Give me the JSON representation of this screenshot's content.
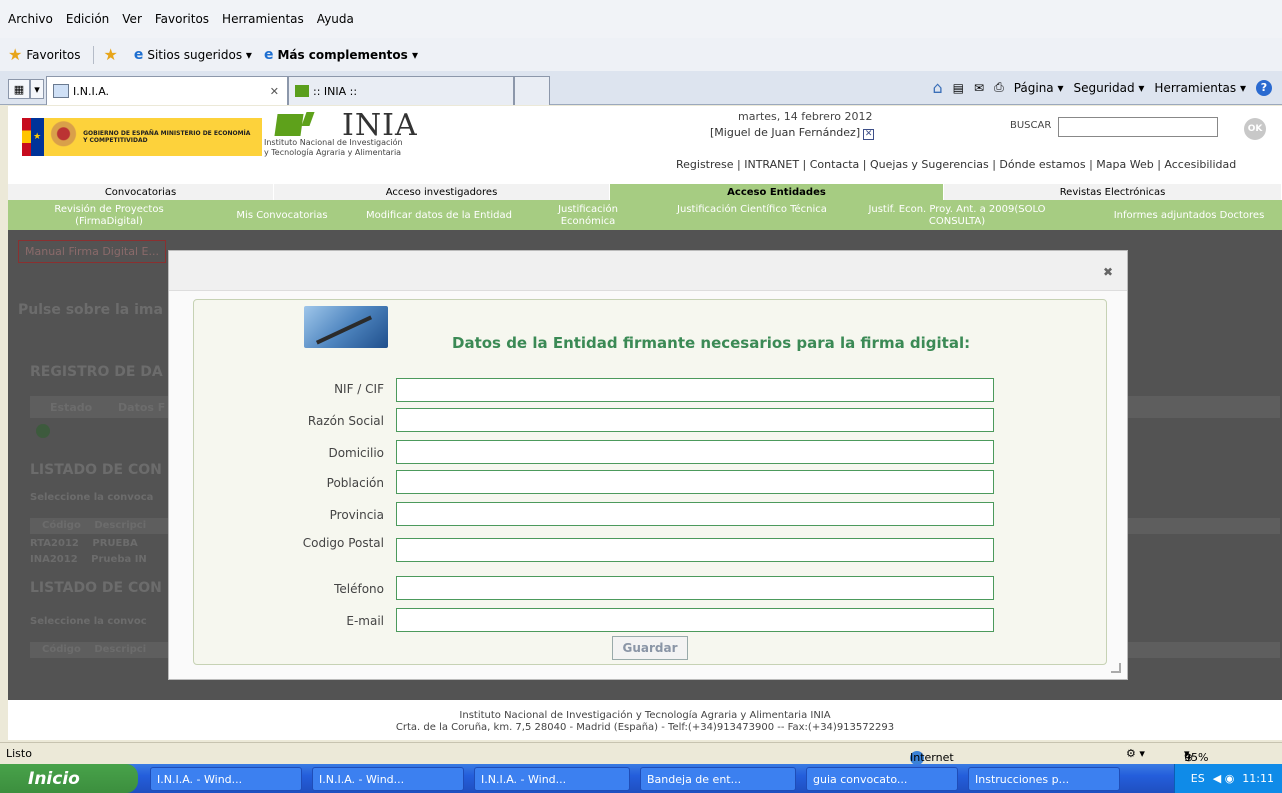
{
  "browser": {
    "menu": [
      "Archivo",
      "Edición",
      "Ver",
      "Favoritos",
      "Herramientas",
      "Ayuda"
    ],
    "favorites_bar": {
      "favorites": "Favoritos",
      "suggested": "Sitios sugeridos ▾",
      "addons": "Más complementos ▾"
    },
    "tabs": [
      {
        "label": "I.N.I.A.",
        "active": true
      },
      {
        "label": ":: INIA ::",
        "active": false
      }
    ],
    "command_bar": [
      "Página ▾",
      "Seguridad ▾",
      "Herramientas ▾"
    ],
    "status": {
      "left": "Listo",
      "zone": "Internet",
      "zoom": "95%"
    }
  },
  "site": {
    "gov_logo_text": "GOBIERNO DE ESPAÑA  MINISTERIO DE ECONOMÍA Y COMPETITIVIDAD",
    "inia_title": "INIA",
    "inia_subtitle_1": "Instituto Nacional de Investigación",
    "inia_subtitle_2": "y Tecnología Agraria y Alimentaria",
    "date": "martes, 14 febrero 2012",
    "user": "[Miguel de Juan Fernández]",
    "search_label": "BUSCAR",
    "search_ok": "OK",
    "top_links": "Registrese | INTRANET | Contacta | Quejas y Sugerencias | Dónde estamos | Mapa Web | Accesibilidad",
    "main_nav": [
      "Convocatorias",
      "Acceso investigadores",
      "Acceso Entidades",
      "Revistas Electrónicas"
    ],
    "sub_nav": [
      "Revisión de Proyectos (FirmaDigital)",
      "Mis Convocatorias",
      "Modificar datos de la Entidad",
      "Justificación Económica",
      "Justificación Científico Técnica",
      "Justif. Econ. Proy. Ant. a 2009(SOLO CONSULTA)",
      "Informes adjuntados Doctores"
    ],
    "background": {
      "manual_btn": "Manual Firma Digital E...",
      "pulse": "Pulse sobre la ima",
      "registro": "REGISTRO DE DA",
      "estado": "Estado",
      "datos": "Datos F",
      "listado1": "LISTADO DE CON",
      "seleccione1": "Seleccione la convoca",
      "codigo": "Código",
      "descrip": "Descripci",
      "row1_code": "RTA2012",
      "row1_desc": "PRUEBA",
      "row2_code": "INA2012",
      "row2_desc": "Prueba IN",
      "listado2": "LISTADO DE CON",
      "seleccione2": "Seleccione la convoc",
      "codigo2": "Código",
      "descrip2": "Descripci"
    },
    "footer_1": "Instituto Nacional de Investigación y Tecnología Agraria y Alimentaria INIA",
    "footer_2": "Crta. de la Coruña, km. 7,5 28040 - Madrid (España) - Telf:(+34)913473900 -- Fax:(+34)913572293"
  },
  "dialog": {
    "close": "✖",
    "title": "Datos de la Entidad firmante necesarios para la firma digital:",
    "fields": [
      {
        "label": "NIF / CIF",
        "value": ""
      },
      {
        "label": "Razón Social",
        "value": ""
      },
      {
        "label": "Domicilio",
        "value": ""
      },
      {
        "label": "Población",
        "value": ""
      },
      {
        "label": "Provincia",
        "value": ""
      },
      {
        "label": "Codigo Postal",
        "value": ""
      },
      {
        "label": "Teléfono",
        "value": ""
      },
      {
        "label": "E-mail",
        "value": ""
      }
    ],
    "save": "Guardar"
  },
  "taskbar": {
    "start": "Inicio",
    "tasks": [
      "I.N.I.A. - Wind...",
      "I.N.I.A. - Wind...",
      "I.N.I.A. - Wind...",
      "Bandeja de ent...",
      "guia convocato...",
      "Instrucciones p..."
    ],
    "lang": "ES",
    "time": "11:11"
  }
}
